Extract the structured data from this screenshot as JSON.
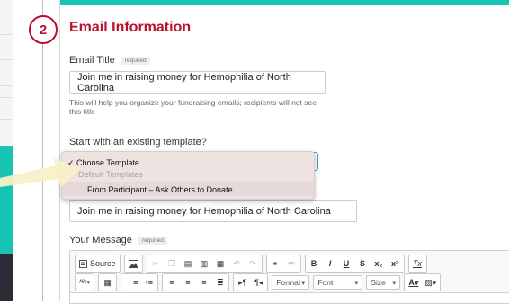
{
  "step": {
    "number": "2"
  },
  "section": {
    "title": "Email Information"
  },
  "email_title": {
    "label": "Email Title",
    "required_badge": "required",
    "value": "Join me in raising money for Hemophilia of North Carolina",
    "help_text": "This will help you organize your fundraising emails; recipients will not see this title"
  },
  "template": {
    "label": "Start with an existing template?",
    "dropdown": {
      "checked_item": "✓ Choose Template",
      "group_label": "Default Templates",
      "option": "From Participant – Ask Others to Donate"
    }
  },
  "subject": {
    "value": "Join me in raising money for Hemophilia of North Carolina"
  },
  "message": {
    "label": "Your Message",
    "required_badge": "required"
  },
  "toolbar": {
    "source_label": "Source",
    "bold": "B",
    "italic": "I",
    "underline": "U",
    "strike": "S",
    "subscript": "x₂",
    "superscript": "x²",
    "remove_format": "Tx",
    "format_label": "Format",
    "font_label": "Font",
    "size_label": "Size"
  },
  "colors": {
    "accent_red": "#b8112a",
    "teal": "#17c3b2",
    "callout": "#f9f0c8"
  }
}
